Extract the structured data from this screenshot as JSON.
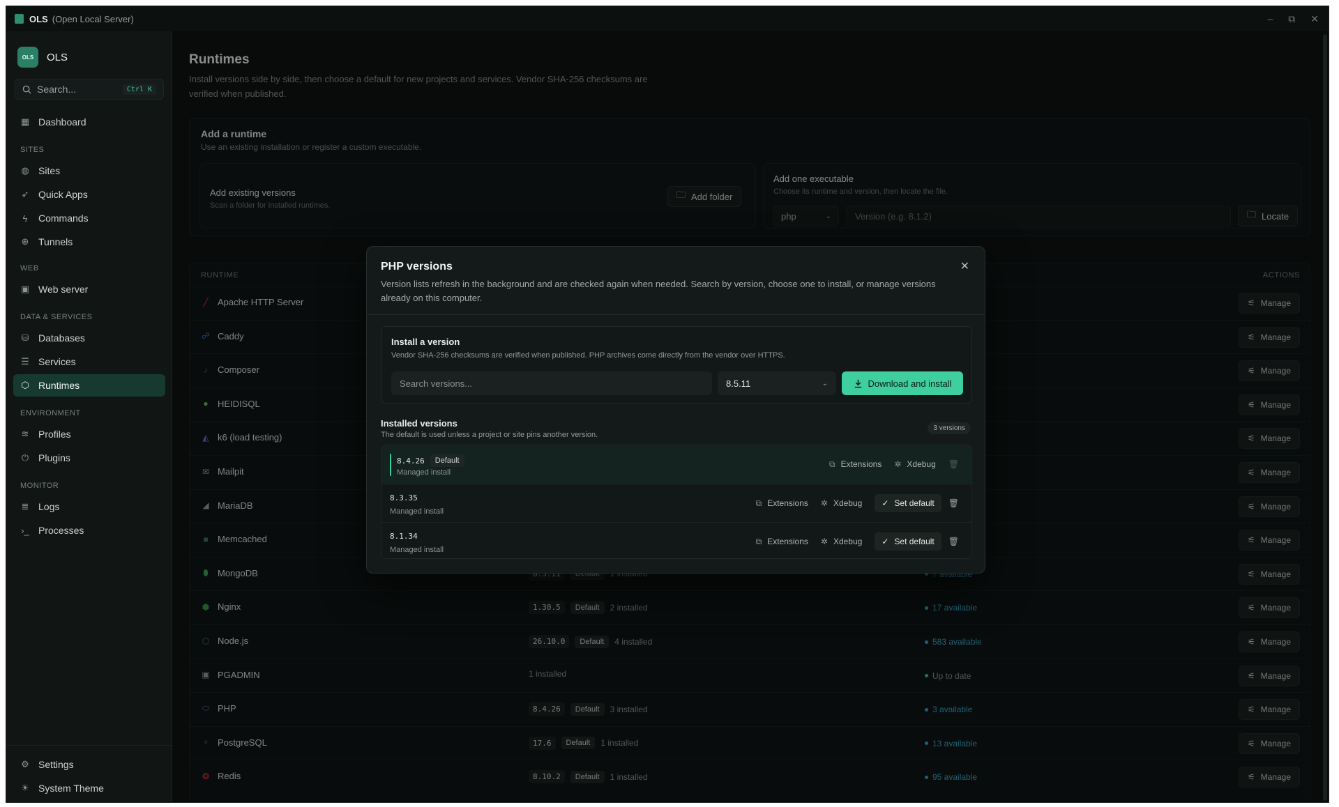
{
  "titlebar": {
    "app": "OLS",
    "subtitle": "(Open Local Server)",
    "minimize": "–",
    "maximize": "⧉",
    "close": "✕"
  },
  "sidebar": {
    "brand": "OLS",
    "logo_text": "OLS",
    "search_placeholder": "Search...",
    "search_shortcut": "Ctrl K",
    "dashboard": "Dashboard",
    "sections": {
      "sites": "SITES",
      "web": "WEB",
      "data": "DATA & SERVICES",
      "env": "ENVIRONMENT",
      "monitor": "MONITOR"
    },
    "items": {
      "sites": "Sites",
      "quick_apps": "Quick Apps",
      "commands": "Commands",
      "tunnels": "Tunnels",
      "web_server": "Web server",
      "databases": "Databases",
      "services": "Services",
      "runtimes": "Runtimes",
      "profiles": "Profiles",
      "plugins": "Plugins",
      "logs": "Logs",
      "processes": "Processes",
      "settings": "Settings",
      "system_theme": "System Theme"
    }
  },
  "page": {
    "title": "Runtimes",
    "description": "Install versions side by side, then choose a default for new projects and services. Vendor SHA-256 checksums are verified when published."
  },
  "add_runtime": {
    "title": "Add a runtime",
    "desc": "Use an existing installation or register a custom executable.",
    "existing_title": "Add existing versions",
    "existing_desc": "Scan a folder for installed runtimes.",
    "add_folder": "Add folder",
    "exec_title": "Add one executable",
    "exec_desc": "Choose its runtime and version, then locate the file.",
    "exec_runtime": "php",
    "exec_version_placeholder": "Version (e.g. 8.1.2)",
    "locate": "Locate"
  },
  "table": {
    "col_runtime": "RUNTIME",
    "col_actions": "ACTIONS",
    "manage": "Manage",
    "rows": [
      {
        "name": "Apache HTTP Server",
        "icon": "feather-icon",
        "glyph": "╱",
        "color": "#d23a3a",
        "version": "",
        "default": "",
        "installed": "",
        "avail": ""
      },
      {
        "name": "Caddy",
        "icon": "caddy-icon",
        "glyph": "☍",
        "color": "#3a6bc9",
        "version": "",
        "default": "",
        "installed": "",
        "avail": ""
      },
      {
        "name": "Composer",
        "icon": "composer-icon",
        "glyph": "♪",
        "color": "#5b6562",
        "version": "",
        "default": "",
        "installed": "",
        "avail": ""
      },
      {
        "name": "HEIDISQL",
        "icon": "heidisql-icon",
        "glyph": "●",
        "color": "#6fb86f",
        "version": "",
        "default": "",
        "installed": "",
        "avail": ""
      },
      {
        "name": "k6 (load testing)",
        "icon": "k6-icon",
        "glyph": "◭",
        "color": "#7d64ff",
        "version": "",
        "default": "",
        "installed": "",
        "avail": ""
      },
      {
        "name": "Mailpit",
        "icon": "mail-icon",
        "glyph": "✉",
        "color": "#9aa19e",
        "version": "",
        "default": "",
        "installed": "",
        "avail": ""
      },
      {
        "name": "MariaDB",
        "icon": "mariadb-icon",
        "glyph": "◢",
        "color": "#9aa19e",
        "version": "",
        "default": "",
        "installed": "",
        "avail": ""
      },
      {
        "name": "Memcached",
        "icon": "memcached-icon",
        "glyph": "■",
        "color": "#3d7a55",
        "version": "",
        "default": "",
        "installed": "",
        "avail": ""
      },
      {
        "name": "MongoDB",
        "icon": "mongodb-icon",
        "glyph": "⬮",
        "color": "#3fa55a",
        "version": "8.3.11",
        "default": "Default",
        "installed": "1 installed",
        "avail": "7 available"
      },
      {
        "name": "Nginx",
        "icon": "nginx-icon",
        "glyph": "⬢",
        "color": "#2f9c4a",
        "version": "1.30.5",
        "default": "Default",
        "installed": "2 installed",
        "avail": "17 available"
      },
      {
        "name": "Node.js",
        "icon": "nodejs-icon",
        "glyph": "⬡",
        "color": "#3f8f3f",
        "version": "26.10.0",
        "default": "Default",
        "installed": "4 installed",
        "avail": "583 available"
      },
      {
        "name": "PGADMIN",
        "icon": "pgadmin-icon",
        "glyph": "▣",
        "color": "#9aa19e",
        "version": "",
        "default": "",
        "installed": "1 installed",
        "avail": "Up to date"
      },
      {
        "name": "PHP",
        "icon": "php-icon",
        "glyph": "⬭",
        "color": "#6b7fc4",
        "version": "8.4.26",
        "default": "Default",
        "installed": "3 installed",
        "avail": "3 available"
      },
      {
        "name": "PostgreSQL",
        "icon": "postgresql-icon",
        "glyph": "♆",
        "color": "#4a6fa8",
        "version": "17.6",
        "default": "Default",
        "installed": "1 installed",
        "avail": "13 available"
      },
      {
        "name": "Redis",
        "icon": "redis-icon",
        "glyph": "❂",
        "color": "#d23a3a",
        "version": "8.10.2",
        "default": "Default",
        "installed": "1 installed",
        "avail": "95 available"
      }
    ]
  },
  "modal": {
    "title": "PHP versions",
    "description": "Version lists refresh in the background and are checked again when needed. Search by version, choose one to install, or manage versions already on this computer.",
    "close": "✕",
    "install_title": "Install a version",
    "install_desc": "Vendor SHA-256 checksums are verified when published. PHP archives come directly from the vendor over HTTPS.",
    "search_placeholder": "Search versions...",
    "selected_version": "8.5.11",
    "download": "Download and install",
    "installed_title": "Installed versions",
    "installed_desc": "The default is used unless a project or site pins another version.",
    "installed_count": "3 versions",
    "extensions": "Extensions",
    "xdebug": "Xdebug",
    "set_default": "Set default",
    "versions": [
      {
        "version": "8.4.26",
        "badge": "Default",
        "source": "Managed install"
      },
      {
        "version": "8.3.35",
        "badge": "",
        "source": "Managed install"
      },
      {
        "version": "8.1.34",
        "badge": "",
        "source": "Managed install"
      }
    ]
  }
}
